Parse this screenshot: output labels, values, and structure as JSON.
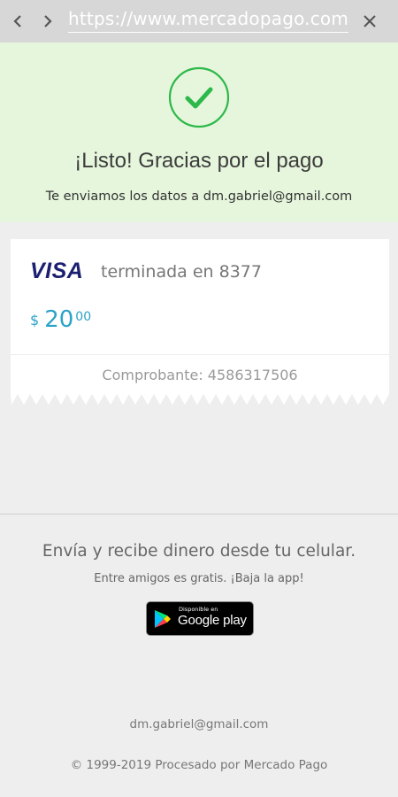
{
  "browser": {
    "url": "https://www.mercadopago.com",
    "back_icon": "chevron-left-icon",
    "forward_icon": "chevron-right-icon",
    "close_icon": "close-icon"
  },
  "success": {
    "icon": "check-circle-icon",
    "title": "¡Listo! Gracias por el pago",
    "subtitle": "Te enviamos los datos a dm.gabriel@gmail.com",
    "background": "#e6f6dc",
    "accent": "#2db84a"
  },
  "payment": {
    "brand": "VISA",
    "card_ending": "terminada en 8377",
    "currency_symbol": "$",
    "amount_integer": "20",
    "amount_decimals": "00",
    "amount_color": "#2aa3c8",
    "receipt": "Comprobante: 4586317506"
  },
  "promo": {
    "title": "Envía y recibe dinero desde tu celular.",
    "subtitle": "Entre amigos es gratis. ¡Baja la app!",
    "store_badge_small": "Disponible en",
    "store_badge_big": "Google play"
  },
  "footer": {
    "email": "dm.gabriel@gmail.com",
    "copyright": "© 1999-2019 Procesado por Mercado Pago"
  }
}
